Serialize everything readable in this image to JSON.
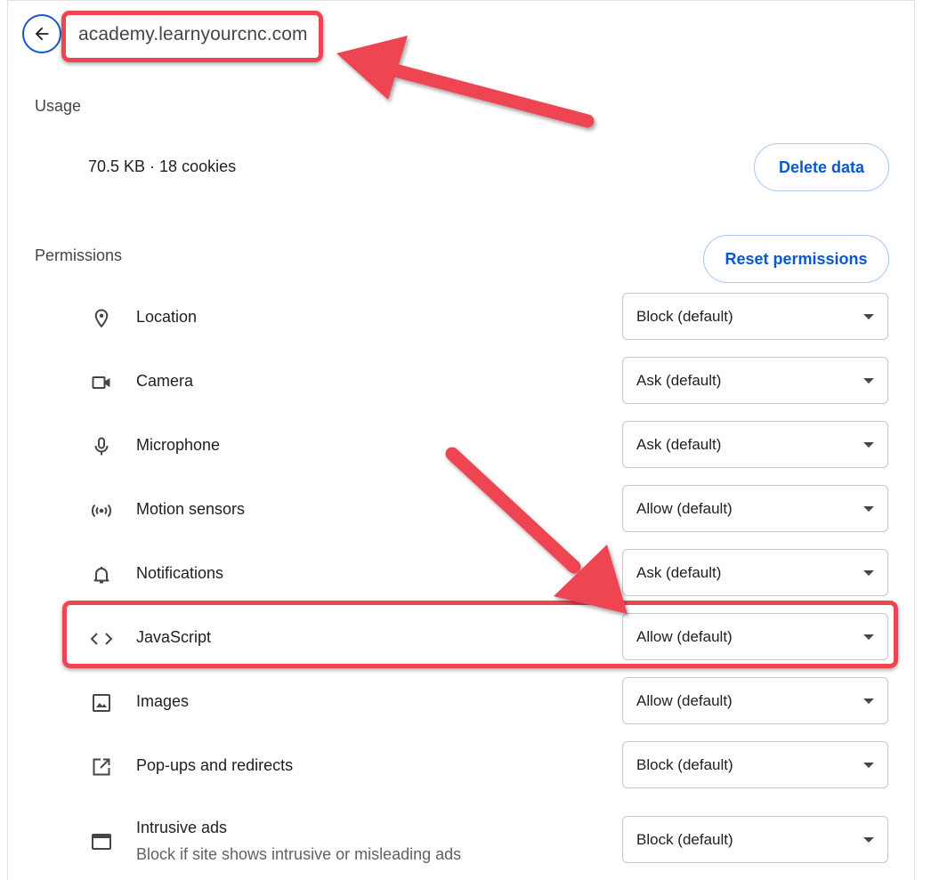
{
  "header": {
    "back_label": "Back",
    "site": "academy.learnyourcnc.com"
  },
  "usage": {
    "heading": "Usage",
    "summary": "70.5 KB · 18 cookies",
    "delete_label": "Delete data"
  },
  "permissions": {
    "heading": "Permissions",
    "reset_label": "Reset permissions",
    "items": [
      {
        "icon": "location-pin-icon",
        "label": "Location",
        "value": "Block (default)"
      },
      {
        "icon": "camera-icon",
        "label": "Camera",
        "value": "Ask (default)"
      },
      {
        "icon": "microphone-icon",
        "label": "Microphone",
        "value": "Ask (default)"
      },
      {
        "icon": "motion-sensors-icon",
        "label": "Motion sensors",
        "value": "Allow (default)"
      },
      {
        "icon": "bell-icon",
        "label": "Notifications",
        "value": "Ask (default)"
      },
      {
        "icon": "code-brackets-icon",
        "label": "JavaScript",
        "value": "Allow (default)"
      },
      {
        "icon": "image-icon",
        "label": "Images",
        "value": "Allow (default)"
      },
      {
        "icon": "open-in-new-icon",
        "label": "Pop-ups and redirects",
        "value": "Block (default)"
      },
      {
        "icon": "browser-window-icon",
        "label": "Intrusive ads",
        "sublabel": "Block if site shows intrusive or misleading ads",
        "value": "Block (default)"
      }
    ]
  },
  "annotations": {
    "highlight_color": "#ef4552",
    "accent_color": "#0b57d0"
  }
}
